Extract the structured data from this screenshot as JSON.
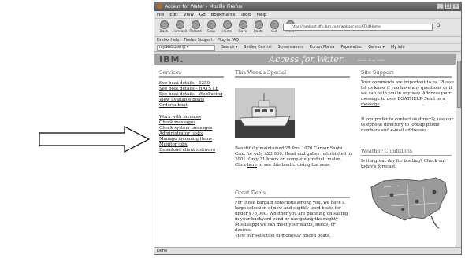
{
  "browser": {
    "title": "Access for Water - Mozilla Firefox",
    "menu": [
      "File",
      "Edit",
      "View",
      "Go",
      "Bookmarks",
      "Tools",
      "Help"
    ],
    "nav_buttons": [
      "Back",
      "Forward",
      "Reload",
      "Stop",
      "Home",
      "Save",
      "Paste",
      "Cut",
      "Print"
    ],
    "url": "http://lambast.dfv.ibm.com/webaccess/ATA4Home",
    "go_label": "G",
    "bookmarks": [
      "Firefox Help",
      "Firefox Support",
      "Plug-in FAQ"
    ],
    "search_placeholder": "my.webuser@ ▾",
    "toolbar_items": [
      "Search ▾",
      "Smiley Central",
      "Screensavers",
      "Cursor Mania",
      "Popswatter",
      "Games ▾",
      "My Info"
    ],
    "status": "Done"
  },
  "page": {
    "logo": "IBM.",
    "banner_title": "Access for Water",
    "banner_sub": "Boats ahoy 2005",
    "services": {
      "title": "Services",
      "links_group1": [
        "See boat details - 5250",
        "See boat details - HATS LE",
        "See boat details - WebFacing",
        "View available boats",
        "Order a boat"
      ],
      "links_group2": [
        "Work with invoices",
        "Check messages",
        "Check system messages",
        "Administrator tasks",
        "Manage incoming items",
        "Monitor jobs",
        "Download client software"
      ]
    },
    "special": {
      "title": "This Week's Special",
      "description": "Beautifully maintained 28 foot 1976 Carver Santa Cruz for only $23,900. Head and galley refurbished in 2001. Only 31 hours on completely rebuilt motor. Click",
      "link": "here",
      "description_end": "to see this boat cruising the seas."
    },
    "deals": {
      "title": "Great Deals",
      "text": "For those bargain conscious among you, we have a large selection of new and slightly used boats for under $75,000. Whether you are planning on sailing in your backyard pond or navigating the mighty Mississippi we can meet your wants, needs, or desires.",
      "link": "View our selection of modestly priced boats."
    },
    "support": {
      "title": "Site Support",
      "text1": "Your comments are important to us. Please let us know if you have any questions or if we can help you in any way. Address your message to user BOATHELP.",
      "link1": "Send us a message",
      "text2_start": "If you prefer to contact us directly, use our",
      "link2": "telephone directory",
      "text2_end": "to lookup phone numbers and e-mail addresses."
    },
    "weather": {
      "title": "Weather Conditions",
      "text": "Is it a great day for boating? Check out today's forecast."
    }
  }
}
